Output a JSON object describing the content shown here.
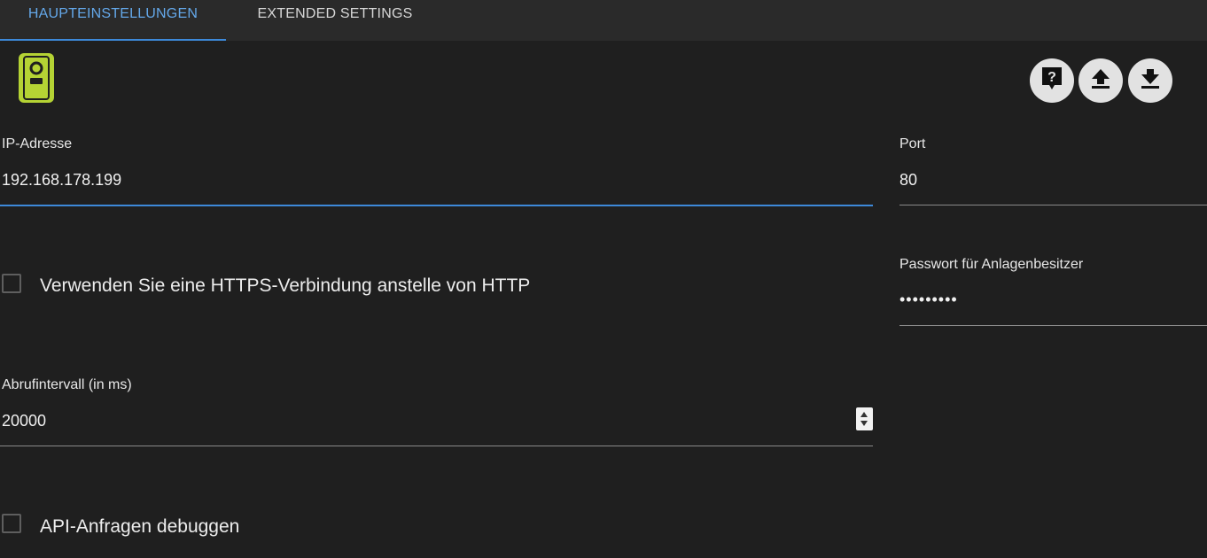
{
  "tabs": [
    {
      "label": "HAUPTEINSTELLUNGEN",
      "active": true
    },
    {
      "label": "EXTENDED SETTINGS",
      "active": false
    }
  ],
  "toolbar": {
    "help_icon": "help-chat-icon",
    "upload_icon": "upload-icon",
    "download_icon": "download-icon"
  },
  "logo": {
    "icon": "adapter-logo-icon",
    "color": "#b5d334"
  },
  "fields": {
    "ip": {
      "label": "IP-Adresse",
      "value": "192.168.178.199"
    },
    "port": {
      "label": "Port",
      "value": "80"
    },
    "password": {
      "label": "Passwort für Anlagenbesitzer",
      "value": "•••••••••"
    },
    "interval": {
      "label": "Abrufintervall (in ms)",
      "value": "20000"
    }
  },
  "checkboxes": {
    "https": {
      "label": "Verwenden Sie eine HTTPS-Verbindung anstelle von HTTP",
      "checked": false
    },
    "debug": {
      "label": "API-Anfragen debuggen",
      "checked": false
    }
  },
  "colors": {
    "background": "#1f1f1f",
    "tabbar": "#2a2a2a",
    "accent": "#3d89d9",
    "active_tab_text": "#64a8ea"
  }
}
